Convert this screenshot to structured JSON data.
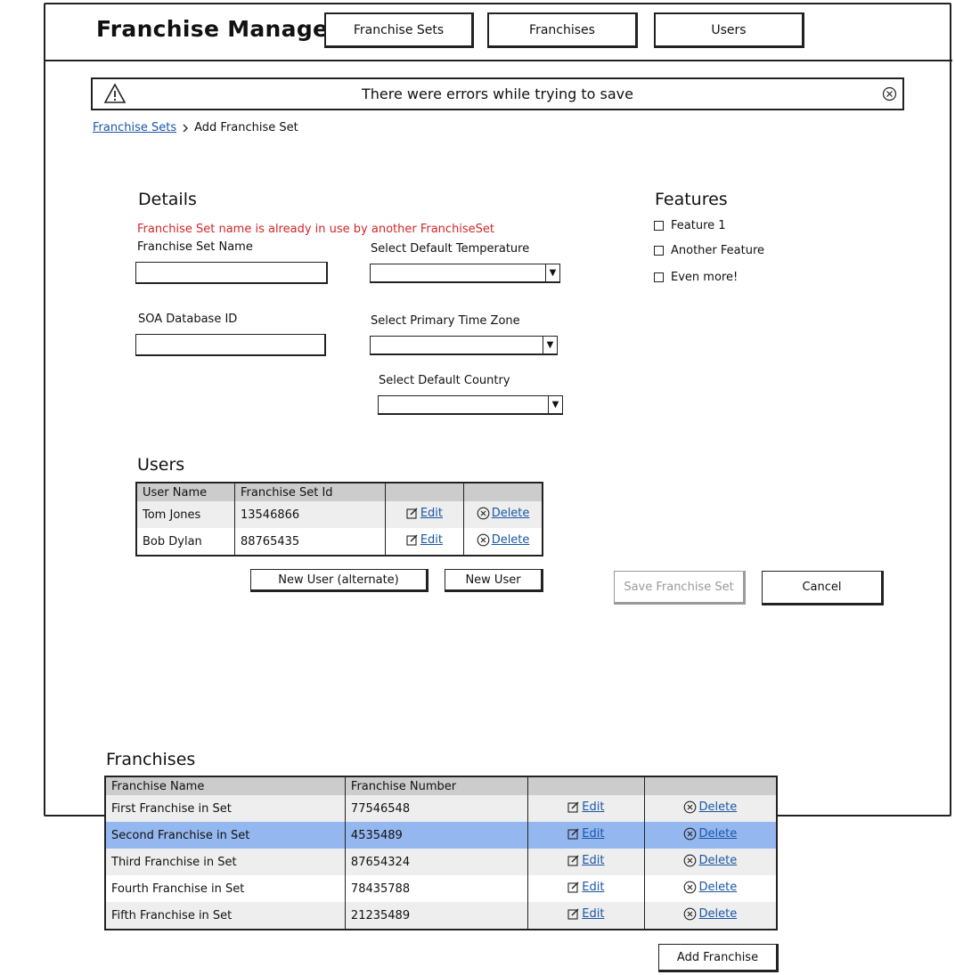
{
  "header": {
    "title": "Franchise Manager",
    "nav": [
      "Franchise Sets",
      "Franchises",
      "Users"
    ]
  },
  "alert": {
    "message": "There were errors while trying to save"
  },
  "breadcrumb": {
    "parent": "Franchise Sets",
    "current": "Add Franchise Set"
  },
  "details": {
    "heading": "Details",
    "error": "Franchise Set name is already in use by another FranchiseSet",
    "name_label": "Franchise Set Name",
    "name_value": "",
    "soa_label": "SOA Database ID",
    "soa_value": "",
    "temp_label": "Select Default Temperature",
    "temp_value": "",
    "tz_label": "Select Primary Time Zone",
    "tz_value": "",
    "country_label": "Select Default Country",
    "country_value": ""
  },
  "features": {
    "heading": "Features",
    "items": [
      "Feature 1",
      "Another Feature",
      "Even more!"
    ]
  },
  "users": {
    "heading": "Users",
    "columns": [
      "User Name",
      "Franchise Set Id",
      "",
      ""
    ],
    "rows": [
      {
        "name": "Tom Jones",
        "id": "13546866",
        "edit": "Edit",
        "delete": "Delete"
      },
      {
        "name": "Bob Dylan",
        "id": "88765435",
        "edit": "Edit",
        "delete": "Delete"
      }
    ],
    "new_alt_label": "New User (alternate)",
    "new_label": "New User"
  },
  "actions": {
    "save_label": "Save Franchise Set",
    "cancel_label": "Cancel"
  },
  "franchises": {
    "heading": "Franchises",
    "columns": [
      "Franchise Name",
      "Franchise Number",
      "",
      ""
    ],
    "rows": [
      {
        "name": "First Franchise in Set",
        "number": "77546548",
        "edit": "Edit",
        "delete": "Delete"
      },
      {
        "name": "Second Franchise in Set",
        "number": "4535489",
        "edit": "Edit",
        "delete": "Delete"
      },
      {
        "name": "Third Franchise in Set",
        "number": "87654324",
        "edit": "Edit",
        "delete": "Delete"
      },
      {
        "name": "Fourth Franchise in Set",
        "number": "78435788",
        "edit": "Edit",
        "delete": "Delete"
      },
      {
        "name": "Fifth Franchise in Set",
        "number": "21235489",
        "edit": "Edit",
        "delete": "Delete"
      }
    ],
    "selected_row": "Second Franchise in Set",
    "add_label": "Add Franchise"
  },
  "colors": {
    "link": "#1a57a6",
    "error": "#d3262b",
    "header_bg": "#cccccc",
    "selected_row": "#95b7ef",
    "alt_row": "#eeeeee"
  }
}
